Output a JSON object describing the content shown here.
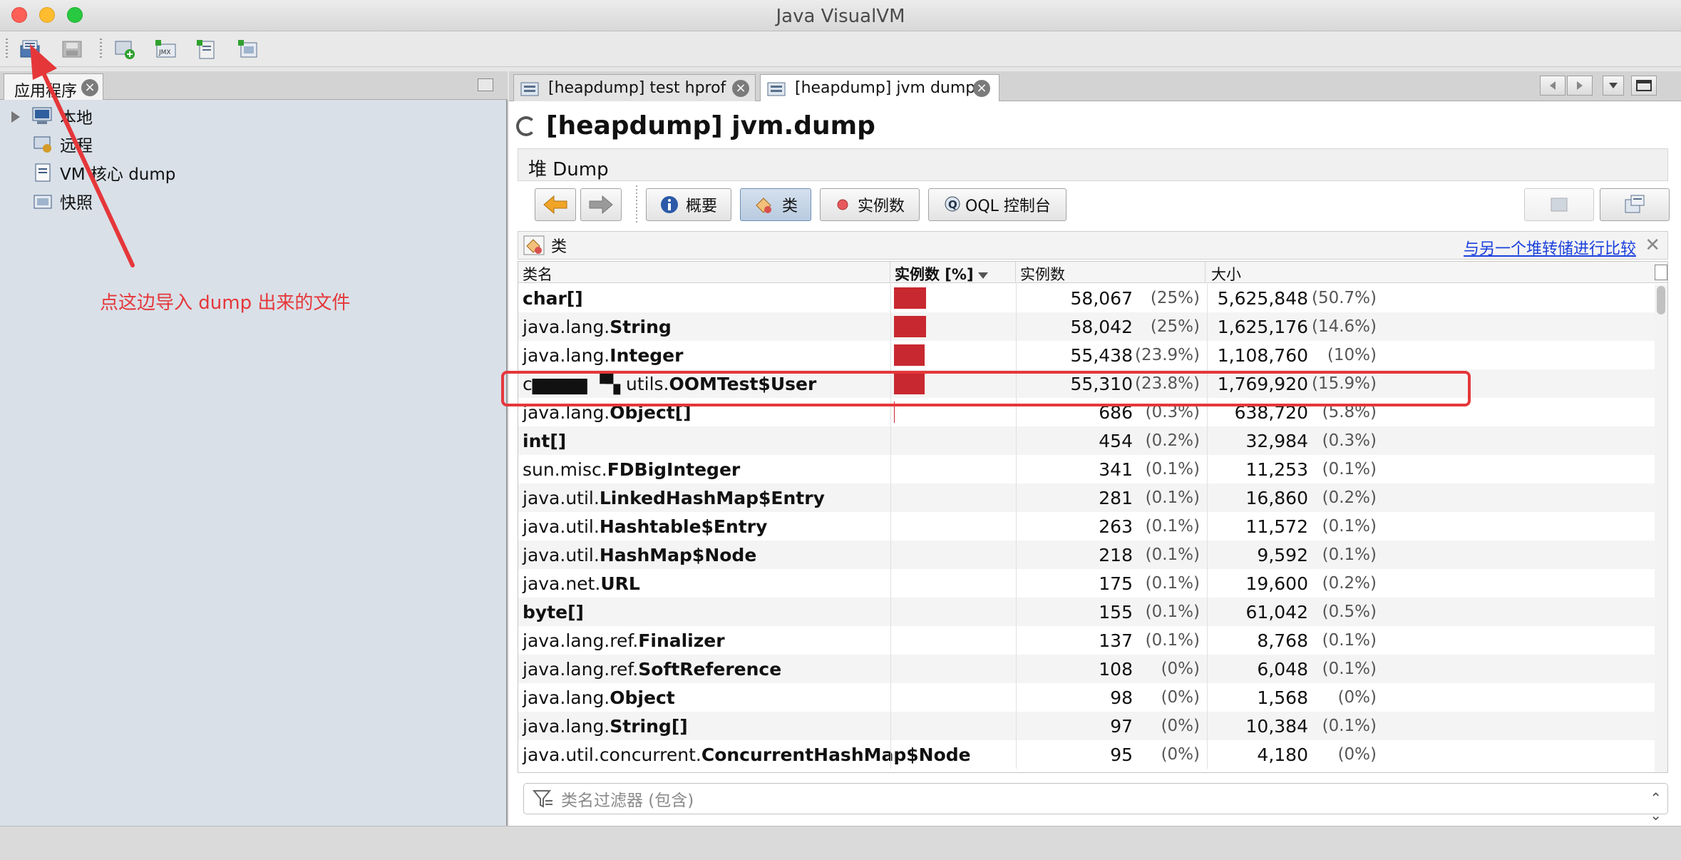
{
  "window": {
    "title": "Java VisualVM"
  },
  "left": {
    "tab_label": "应用程序",
    "tree": [
      {
        "label": "本地"
      },
      {
        "label": "远程"
      },
      {
        "label": "VM 核心 dump"
      },
      {
        "label": "快照"
      }
    ]
  },
  "annotation": "点这边导入 dump 出来的文件",
  "doc_tabs": [
    {
      "label": "[heapdump] test hprof"
    },
    {
      "label": "[heapdump] jvm dump"
    }
  ],
  "content": {
    "title": "[heapdump] jvm.dump",
    "subheader": "堆 Dump",
    "nav": {
      "summary": "概要",
      "classes": "类",
      "instances": "实例数",
      "oql": "OQL 控制台"
    },
    "section_title": "类",
    "compare_link": "与另一个堆转储进行比较",
    "columns": {
      "name": "类名",
      "instances_pct": "实例数 [%]",
      "instances": "实例数",
      "size": "大小"
    },
    "filter_placeholder": "类名过滤器 (包含)"
  },
  "rows": [
    {
      "prefix": "",
      "name": "char[]",
      "bar_pct": 25,
      "count": "58,067",
      "count_pct": "(25%)",
      "size": "5,625,848",
      "size_pct": "(50.7%)"
    },
    {
      "prefix": "java.lang.",
      "name": "String",
      "bar_pct": 25,
      "count": "58,042",
      "count_pct": "(25%)",
      "size": "1,625,176",
      "size_pct": "(14.6%)"
    },
    {
      "prefix": "java.lang.",
      "name": "Integer",
      "bar_pct": 23.9,
      "count": "55,438",
      "count_pct": "(23.9%)",
      "size": "1,108,760",
      "size_pct": "(10%)"
    },
    {
      "prefix": "c▆▆▆▆   ▝▚ utils.",
      "name": "OOMTest$User",
      "bar_pct": 23.8,
      "count": "55,310",
      "count_pct": "(23.8%)",
      "size": "1,769,920",
      "size_pct": "(15.9%)"
    },
    {
      "prefix": "java.lang.",
      "name": "Object[]",
      "bar_pct": 0.3,
      "count": "686",
      "count_pct": "(0.3%)",
      "size": "638,720",
      "size_pct": "(5.8%)"
    },
    {
      "prefix": "",
      "name": "int[]",
      "bar_pct": 0.2,
      "count": "454",
      "count_pct": "(0.2%)",
      "size": "32,984",
      "size_pct": "(0.3%)"
    },
    {
      "prefix": "sun.misc.",
      "name": "FDBigInteger",
      "bar_pct": 0.1,
      "count": "341",
      "count_pct": "(0.1%)",
      "size": "11,253",
      "size_pct": "(0.1%)"
    },
    {
      "prefix": "java.util.",
      "name": "LinkedHashMap$Entry",
      "bar_pct": 0.1,
      "count": "281",
      "count_pct": "(0.1%)",
      "size": "16,860",
      "size_pct": "(0.2%)"
    },
    {
      "prefix": "java.util.",
      "name": "Hashtable$Entry",
      "bar_pct": 0.1,
      "count": "263",
      "count_pct": "(0.1%)",
      "size": "11,572",
      "size_pct": "(0.1%)"
    },
    {
      "prefix": "java.util.",
      "name": "HashMap$Node",
      "bar_pct": 0.1,
      "count": "218",
      "count_pct": "(0.1%)",
      "size": "9,592",
      "size_pct": "(0.1%)"
    },
    {
      "prefix": "java.net.",
      "name": "URL",
      "bar_pct": 0.1,
      "count": "175",
      "count_pct": "(0.1%)",
      "size": "19,600",
      "size_pct": "(0.2%)"
    },
    {
      "prefix": "",
      "name": "byte[]",
      "bar_pct": 0.1,
      "count": "155",
      "count_pct": "(0.1%)",
      "size": "61,042",
      "size_pct": "(0.5%)"
    },
    {
      "prefix": "java.lang.ref.",
      "name": "Finalizer",
      "bar_pct": 0.1,
      "count": "137",
      "count_pct": "(0.1%)",
      "size": "8,768",
      "size_pct": "(0.1%)"
    },
    {
      "prefix": "java.lang.ref.",
      "name": "SoftReference",
      "bar_pct": 0,
      "count": "108",
      "count_pct": "(0%)",
      "size": "6,048",
      "size_pct": "(0.1%)"
    },
    {
      "prefix": "java.lang.",
      "name": "Object",
      "bar_pct": 0,
      "count": "98",
      "count_pct": "(0%)",
      "size": "1,568",
      "size_pct": "(0%)"
    },
    {
      "prefix": "java.lang.",
      "name": "String[]",
      "bar_pct": 0,
      "count": "97",
      "count_pct": "(0%)",
      "size": "10,384",
      "size_pct": "(0.1%)"
    },
    {
      "prefix": "java.util.concurrent.",
      "name": "ConcurrentHashMap$Node",
      "bar_pct": 0,
      "count": "95",
      "count_pct": "(0%)",
      "size": "4,180",
      "size_pct": "(0%)"
    }
  ],
  "colors": {
    "bar": "#c8282f",
    "annotation": "#e5373a",
    "link": "#1a3fdd"
  }
}
